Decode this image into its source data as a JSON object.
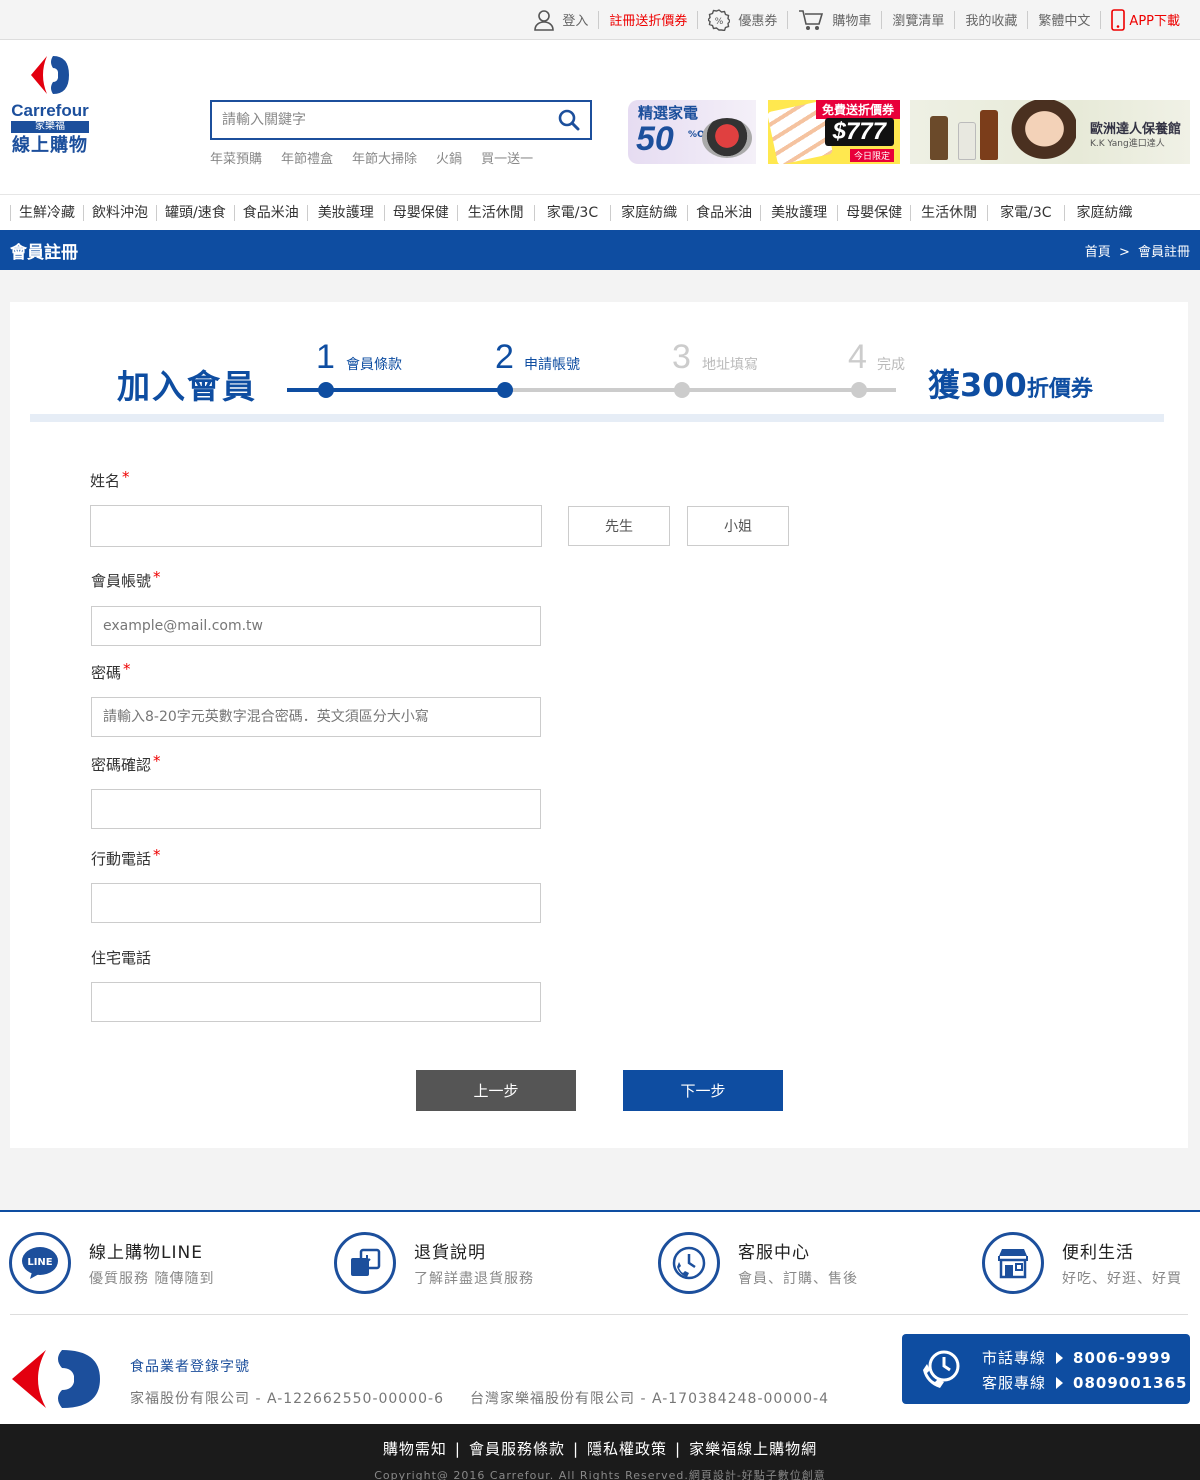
{
  "topbar": {
    "login": "登入",
    "register_promo": "註冊送折價券",
    "coupons": "優惠券",
    "cart": "購物車",
    "history": "瀏覽清單",
    "favorites": "我的收藏",
    "language": "繁體中文",
    "app": "APP下載"
  },
  "logo": {
    "brand": "Carrefour",
    "cn": "家樂福",
    "tagline": "線上購物"
  },
  "search": {
    "placeholder": "請輸入關鍵字",
    "hotwords": [
      "年菜預購",
      "年節禮盒",
      "年節大掃除",
      "火鍋",
      "買一送一"
    ]
  },
  "banners": {
    "b1_title": "精選家電",
    "b1_num": "50",
    "b1_off": "%OFF",
    "b2_tag": "免費送折價券",
    "b2_price": "$777",
    "b2_limit": "今日限定",
    "b3_title": "歐洲達人保養館",
    "b3_sub": "K.K Yang進口達人"
  },
  "categories": [
    "生鮮冷藏",
    "飲料沖泡",
    "罐頭/速食",
    "食品米油",
    "美妝護理",
    "母嬰保健",
    "生活休閒",
    "家電/3C",
    "家庭紡織",
    "食品米油",
    "美妝護理",
    "母嬰保健",
    "生活休閒",
    "家電/3C",
    "家庭紡織"
  ],
  "page": {
    "title": "會員註冊",
    "breadcrumb_home": "首頁",
    "breadcrumb_sep": ">",
    "breadcrumb_current": "會員註冊"
  },
  "steps": {
    "heading": "加入會員",
    "items": [
      {
        "num": "1",
        "label": "會員條款",
        "state": "done"
      },
      {
        "num": "2",
        "label": "申請帳號",
        "state": "active"
      },
      {
        "num": "3",
        "label": "地址填寫",
        "state": "todo"
      },
      {
        "num": "4",
        "label": "完成",
        "state": "todo"
      }
    ],
    "reward_big": "獲300",
    "reward_small": "折價券",
    "progress_step": 2
  },
  "form": {
    "name_label": "姓名",
    "name_value": "",
    "gender_mr": "先生",
    "gender_ms": "小姐",
    "account_label": "會員帳號",
    "account_placeholder": "example@mail.com.tw",
    "password_label": "密碼",
    "password_placeholder": "請輸入8-20字元英數字混合密碼．英文須區分大小寫",
    "confirm_label": "密碼確認",
    "mobile_label": "行動電話",
    "home_phone_label": "住宅電話",
    "required_mark": "*",
    "prev_button": "上一步",
    "next_button": "下一步"
  },
  "services": [
    {
      "title": "線上購物LINE",
      "subtitle": "優質服務 隨傳隨到",
      "icon": "line-icon"
    },
    {
      "title": "退貨說明",
      "subtitle": "了解詳盡退貨服務",
      "icon": "return-icon"
    },
    {
      "title": "客服中心",
      "subtitle": "會員、訂購、售後",
      "icon": "customer-service-icon"
    },
    {
      "title": "便利生活",
      "subtitle": "好吃、好逛、好買",
      "icon": "store-icon"
    }
  ],
  "footer": {
    "license_heading": "食品業者登錄字號",
    "license_1": "家福股份有限公司 - A-122662550-00000-6",
    "license_2": "台灣家樂福股份有限公司 - A-170384248-00000-4",
    "hotline_local_label": "市話專線",
    "hotline_local_number": "8006-9999",
    "hotline_service_label": "客服專線",
    "hotline_service_number": "0809001365",
    "links": [
      "購物需知",
      "會員服務條款",
      "隱私權政策",
      "家樂福線上購物網"
    ],
    "copyright": "Copyright@ 2016 Carrefour. All Rights Reserved.網頁設計-好點子數位創意"
  },
  "colors": {
    "brand_blue": "#0e4da1",
    "brand_red": "#e3000f",
    "required": "#ee0000"
  }
}
